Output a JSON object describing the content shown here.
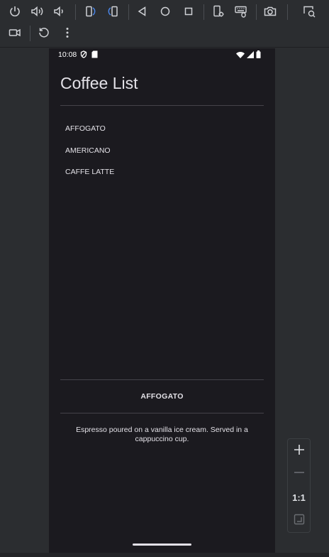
{
  "toolbar": {
    "row1": [
      "power-icon",
      "volume-up-icon",
      "volume-down-icon",
      "rotate-left-icon",
      "rotate-right-icon",
      "back-icon",
      "home-icon",
      "overview-icon",
      "device-settings-icon",
      "keyboard-mouse-icon",
      "camera-icon",
      "zoom-window-icon"
    ],
    "row2": [
      "record-screen-icon",
      "reset-icon",
      "more-options-icon"
    ]
  },
  "status_bar": {
    "time": "10:08",
    "left_icons": [
      "vpn-shield-icon",
      "sd-card-icon"
    ],
    "right_icons": [
      "wifi-icon",
      "cellular-signal-icon",
      "battery-icon"
    ]
  },
  "app": {
    "title": "Coffee List",
    "items": [
      {
        "label": "AFFOGATO"
      },
      {
        "label": "AMERICANO"
      },
      {
        "label": "CAFFE LATTE"
      }
    ],
    "detail": {
      "name": "AFFOGATO",
      "description": "Espresso poured on a vanilla ice cream. Served in a cappuccino cup."
    }
  },
  "zoom_panel": {
    "zoom_in": "plus-icon",
    "zoom_out": "minus-icon",
    "actual_size_label": "1:1",
    "fit_screen": "fit-screen-icon"
  },
  "colors": {
    "toolbar_bg": "#2b2d30",
    "screen_bg": "#1b1a1f",
    "text": "#e3e1e7",
    "divider": "#45434a",
    "rotate_accent": "#4a86e8"
  }
}
